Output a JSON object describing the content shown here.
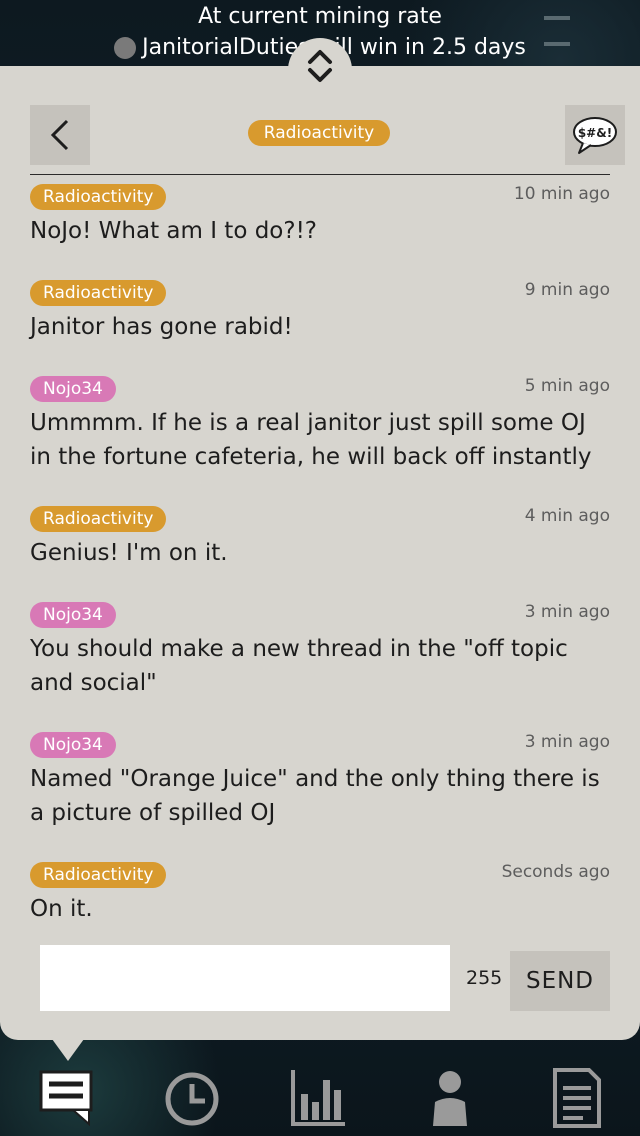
{
  "banner": {
    "line1": "At current mining rate",
    "line2": "JanitorialDuties will win in 2.5 days"
  },
  "header": {
    "channel": "Radioactivity",
    "censor_label": "$#&!"
  },
  "messages": [
    {
      "user": "Radioactivity",
      "color": "#d89a2e",
      "time": "10 min ago",
      "text": "NoJo! What am I to do?!?"
    },
    {
      "user": "Radioactivity",
      "color": "#d89a2e",
      "time": "9 min ago",
      "text": "Janitor has gone rabid!"
    },
    {
      "user": "Nojo34",
      "color": "#d879b6",
      "time": "5 min ago",
      "text": "Ummmm. If he is a real janitor just spill some OJ in the fortune cafeteria, he will back off instantly"
    },
    {
      "user": "Radioactivity",
      "color": "#d89a2e",
      "time": "4 min ago",
      "text": "Genius! I'm on it."
    },
    {
      "user": "Nojo34",
      "color": "#d879b6",
      "time": "3 min ago",
      "text": "You should make a new thread in the \"off topic and social\""
    },
    {
      "user": "Nojo34",
      "color": "#d879b6",
      "time": "3 min ago",
      "text": "Named \"Orange Juice\" and the only thing there is a picture of spilled OJ"
    },
    {
      "user": "Radioactivity",
      "color": "#d89a2e",
      "time": "Seconds ago",
      "text": "On it."
    }
  ],
  "composer": {
    "value": "",
    "char_count": "255",
    "send_label": "SEND"
  },
  "tabs": [
    {
      "name": "chat",
      "icon": "chat-icon",
      "active": true
    },
    {
      "name": "time",
      "icon": "clock-icon",
      "active": false
    },
    {
      "name": "stats",
      "icon": "bar-chart-icon",
      "active": false
    },
    {
      "name": "profile",
      "icon": "person-icon",
      "active": false
    },
    {
      "name": "notes",
      "icon": "document-icon",
      "active": false
    }
  ],
  "colors": {
    "panel": "#d7d5cf",
    "button": "#c5c2bc",
    "badge_orange": "#d89a2e",
    "badge_pink": "#d879b6"
  }
}
